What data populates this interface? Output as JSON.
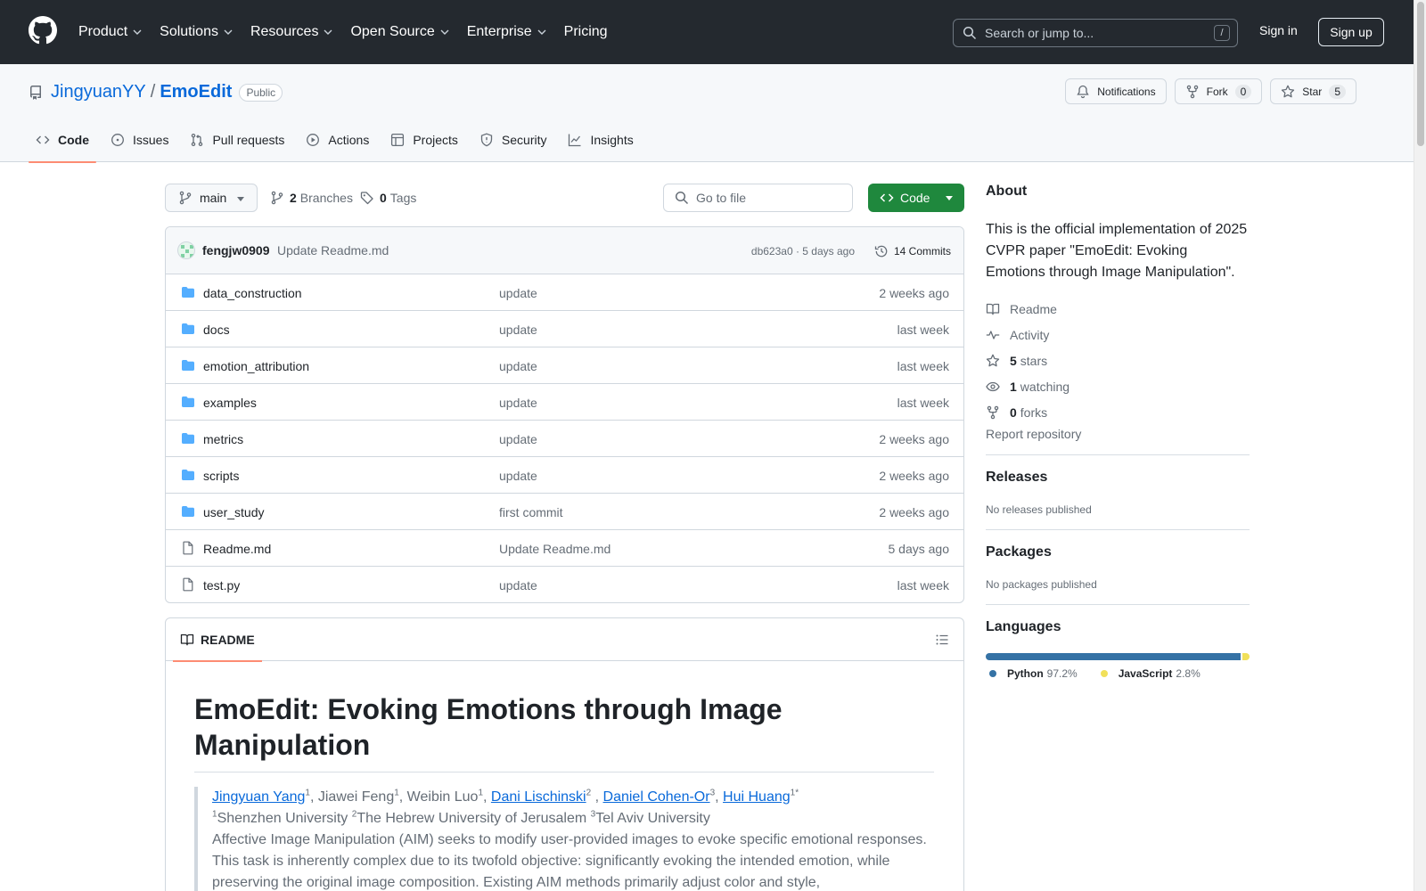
{
  "header": {
    "nav": [
      "Product",
      "Solutions",
      "Resources",
      "Open Source",
      "Enterprise",
      "Pricing"
    ],
    "search_placeholder": "Search or jump to...",
    "search_shortcut": "/",
    "sign_in": "Sign in",
    "sign_up": "Sign up"
  },
  "repo": {
    "owner": "JingyuanYY",
    "separator": "/",
    "name": "EmoEdit",
    "visibility": "Public",
    "notifications": "Notifications",
    "fork_label": "Fork",
    "fork_count": "0",
    "star_label": "Star",
    "star_count": "5",
    "tabs": [
      "Code",
      "Issues",
      "Pull requests",
      "Actions",
      "Projects",
      "Security",
      "Insights"
    ]
  },
  "filebar": {
    "branch": "main",
    "branches_count": "2",
    "branches_label": "Branches",
    "tags_count": "0",
    "tags_label": "Tags",
    "goto_placeholder": "Go to file",
    "code_button": "Code"
  },
  "commit": {
    "author": "fengjw0909",
    "message": "Update Readme.md",
    "hash_time": "db623a0 · 5 days ago",
    "count": "14 Commits"
  },
  "files": [
    {
      "name": "data_construction",
      "type": "dir",
      "message": "update",
      "time": "2 weeks ago"
    },
    {
      "name": "docs",
      "type": "dir",
      "message": "update",
      "time": "last week"
    },
    {
      "name": "emotion_attribution",
      "type": "dir",
      "message": "update",
      "time": "last week"
    },
    {
      "name": "examples",
      "type": "dir",
      "message": "update",
      "time": "last week"
    },
    {
      "name": "metrics",
      "type": "dir",
      "message": "update",
      "time": "2 weeks ago"
    },
    {
      "name": "scripts",
      "type": "dir",
      "message": "update",
      "time": "2 weeks ago"
    },
    {
      "name": "user_study",
      "type": "dir",
      "message": "first commit",
      "time": "2 weeks ago"
    },
    {
      "name": "Readme.md",
      "type": "file",
      "message": "Update Readme.md",
      "time": "5 days ago"
    },
    {
      "name": "test.py",
      "type": "file",
      "message": "update",
      "time": "last week"
    }
  ],
  "readme": {
    "tab": "README",
    "title": "EmoEdit: Evoking Emotions through Image Manipulation",
    "authors": [
      {
        "name": "Jingyuan Yang",
        "sup": "1",
        "link": true
      },
      {
        "name": "Jiawei Feng",
        "sup": "1",
        "link": false
      },
      {
        "name": "Weibin Luo",
        "sup": "1",
        "link": false
      },
      {
        "name": "Dani Lischinski",
        "sup": "2",
        "link": true
      },
      {
        "name": "Daniel Cohen-Or",
        "sup": "3",
        "link": true
      },
      {
        "name": "Hui Huang",
        "sup": "1*",
        "link": true
      }
    ],
    "affiliations": [
      {
        "sup": "1",
        "name": "Shenzhen University"
      },
      {
        "sup": "2",
        "name": "The Hebrew University of Jerusalem"
      },
      {
        "sup": "3",
        "name": "Tel Aviv University"
      }
    ],
    "abstract": "Affective Image Manipulation (AIM) seeks to modify user-provided images to evoke specific emotional responses. This task is inherently complex due to its twofold objective: significantly evoking the intended emotion, while preserving the original image composition. Existing AIM methods primarily adjust color and style,"
  },
  "sidebar": {
    "about_title": "About",
    "description": "This is the official implementation of 2025 CVPR paper \"EmoEdit: Evoking Emotions through Image Manipulation\".",
    "readme": "Readme",
    "activity": "Activity",
    "stars_count": "5",
    "stars_label": "stars",
    "watching_count": "1",
    "watching_label": "watching",
    "forks_count": "0",
    "forks_label": "forks",
    "report": "Report repository",
    "releases_title": "Releases",
    "releases_empty": "No releases published",
    "packages_title": "Packages",
    "packages_empty": "No packages published",
    "languages_title": "Languages",
    "languages": [
      {
        "name": "Python",
        "percent": "97.2%",
        "value": 97.2,
        "color": "#3572A5"
      },
      {
        "name": "JavaScript",
        "percent": "2.8%",
        "value": 2.8,
        "color": "#f1e05a"
      }
    ]
  },
  "colors": {
    "header_bg": "#24292f",
    "link": "#0969da",
    "primary_button": "#1f883d",
    "active_tab_underline": "#fd8c73",
    "folder": "#54aeff"
  }
}
